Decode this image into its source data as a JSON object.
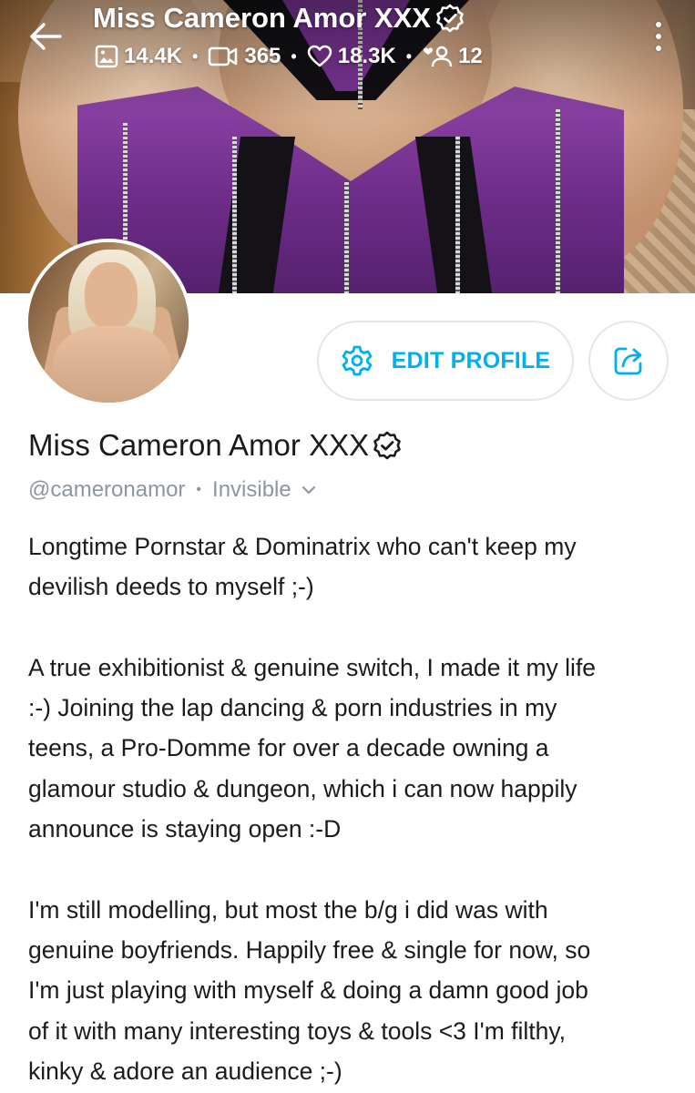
{
  "header": {
    "title": "Miss Cameron Amor XXX",
    "stats": {
      "photos": "14.4K",
      "videos": "365",
      "likes": "18.3K",
      "fans": "12"
    }
  },
  "profile": {
    "name": "Miss Cameron Amor XXX",
    "handle": "@cameronamor",
    "status": "Invisible",
    "edit_label": "EDIT PROFILE"
  },
  "bio": {
    "lines": [
      "Longtime Pornstar & Dominatrix who can't keep my",
      "devilish deeds to myself ;-)",
      "",
      "A true exhibitionist & genuine switch, I made it my life",
      ":-) Joining the lap dancing & porn industries in my",
      "teens, a Pro-Domme for over a decade owning a",
      "glamour studio & dungeon, which i can now happily",
      "announce is staying open :-D",
      "",
      "I'm still modelling, but most the b/g i did was with",
      "genuine boyfriends. Happily free & single for now, so",
      "I'm just playing with myself & doing a damn good job",
      "of it with many interesting toys & tools <3 I'm filthy,",
      "kinky & adore an audience ;-)"
    ]
  },
  "icons": {
    "back": "arrow-left-icon",
    "verified": "verified-badge-icon",
    "photos": "image-icon",
    "videos": "video-icon",
    "likes": "heart-icon",
    "fans": "users-icon",
    "more": "more-vertical-icon",
    "settings": "gear-icon",
    "share": "share-icon",
    "chevron": "chevron-down-icon"
  },
  "colors": {
    "accent": "#00aff0",
    "text": "#1b1b1b",
    "muted": "#8a96a3",
    "border": "#e3e6e9"
  }
}
